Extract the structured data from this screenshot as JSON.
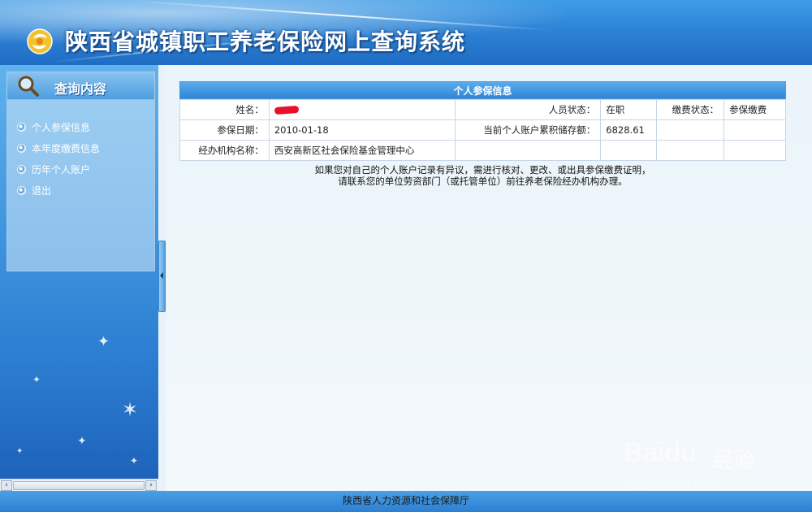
{
  "header": {
    "title": "陕西省城镇职工养老保险网上查询系统"
  },
  "sidebar": {
    "heading": "查询内容",
    "items": [
      {
        "label": "个人参保信息"
      },
      {
        "label": "本年度缴费信息"
      },
      {
        "label": "历年个人账户"
      },
      {
        "label": "退出"
      }
    ]
  },
  "panel": {
    "title": "个人参保信息",
    "rows": [
      {
        "l1": "姓名：",
        "v1": "",
        "l2": "人员状态：",
        "v2": "在职",
        "l3": "缴费状态：",
        "v3": "参保缴费"
      },
      {
        "l1": "参保日期：",
        "v1": "2010-01-18",
        "l2": "当前个人账户累积储存额：",
        "v2": "6828.61",
        "l3": "",
        "v3": ""
      },
      {
        "l1": "经办机构名称：",
        "v1": "西安高新区社会保险基金管理中心",
        "l2": "",
        "v2": "",
        "l3": "",
        "v3": ""
      }
    ],
    "notice_line1": "如果您对自己的个人账户记录有异议，需进行核对、更改、或出具参保缴费证明，",
    "notice_line2": "请联系您的单位劳资部门（或托管单位）前往养老保险经办机构办理。"
  },
  "footer": {
    "text": "陕西省人力资源和社会保障厅"
  },
  "watermark": {
    "brand": "Bai",
    "brand2": "du",
    "cn": "经验",
    "url": "jingyan.baidu.com"
  },
  "colors": {
    "header_blue": "#2d84d6",
    "panel_head": "#2f86d8",
    "redaction": "#e8102a"
  },
  "icons": [
    "logo-icon",
    "magnifier-icon",
    "radio-bullet-icon",
    "collapse-arrow-icon",
    "scroll-left-icon",
    "scroll-right-icon"
  ]
}
